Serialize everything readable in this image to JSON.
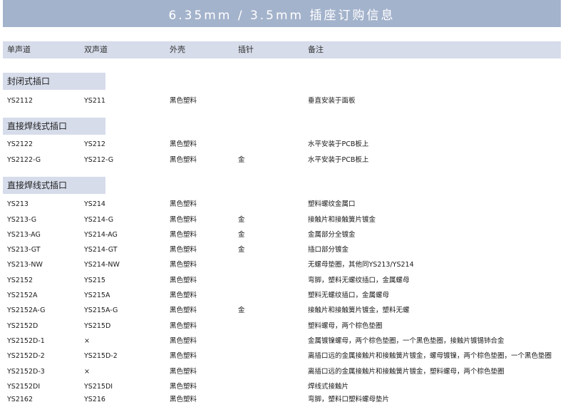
{
  "title": "6.35mm / 3.5mm 插座订购信息",
  "headers": [
    "单声道",
    "双声道",
    "外壳",
    "插针",
    "备注"
  ],
  "sections": [
    {
      "name": "封闭式插口",
      "rows": [
        [
          "YS2112",
          "YS211",
          "黑色塑料",
          "",
          "垂直安装于面板"
        ]
      ]
    },
    {
      "name": "直接焊线式插口",
      "rows": [
        [
          "YS2122",
          "YS212",
          "黑色塑料",
          "",
          "水平安装于PCB板上"
        ],
        [
          "YS2122-G",
          "YS212-G",
          "黑色塑料",
          "金",
          "水平安装于PCB板上"
        ]
      ]
    },
    {
      "name": "直接焊线式插口",
      "rows": [
        [
          "YS213",
          "YS214",
          "黑色塑料",
          "",
          "塑料螺纹金属口"
        ],
        [
          "YS213-G",
          "YS214-G",
          "黑色塑料",
          "金",
          "接触片和接触簧片镀金"
        ],
        [
          "YS213-AG",
          "YS214-AG",
          "黑色塑料",
          "金",
          "金属部分全镀金"
        ],
        [
          "YS213-GT",
          "YS214-GT",
          "黑色塑料",
          "金",
          "插口部分镀金"
        ],
        [
          "YS213-NW",
          "YS214-NW",
          "黑色塑料",
          "",
          "无螺母垫圈，其他同YS213/YS214"
        ],
        [
          "YS2152",
          "YS215",
          "黑色塑料",
          "",
          "弯脚，塑料无螺纹插口，金属螺母"
        ],
        [
          "YS2152A",
          "YS215A",
          "黑色塑料",
          "",
          "塑料无螺纹插口，金属螺母"
        ],
        [
          "YS2152A-G",
          "YS215A-G",
          "黑色塑料",
          "金",
          "接触片和接触簧片镀金，塑料无螺"
        ],
        [
          "YS2152D",
          "YS215D",
          "黑色塑料",
          "",
          "塑料螺母，两个棕色垫圈"
        ],
        [
          "YS2152D-1",
          "×",
          "黑色塑料",
          "",
          "金属镀镍螺母，两个棕色垫圈，一个黑色垫圈，接触片镀锡铈合金"
        ],
        [
          "YS2152D-2",
          "YS215D-2",
          "黑色塑料",
          "",
          "离插口远的金属接触片和接触簧片镀金，螺母镀镍，两个棕色垫圈，一个黑色垫圈"
        ],
        [
          "YS2152D-3",
          "×",
          "黑色塑料",
          "",
          "离插口远的金属接触片和接触簧片镀金，塑料螺母，两个棕色垫圈"
        ],
        [
          "YS2152DI",
          "YS215DI",
          "黑色塑料",
          "",
          "焊线式接触片"
        ],
        [
          "YS2162",
          "YS216",
          "黑色塑料",
          "",
          "弯脚，塑料口塑料螺母垫片"
        ]
      ]
    }
  ]
}
